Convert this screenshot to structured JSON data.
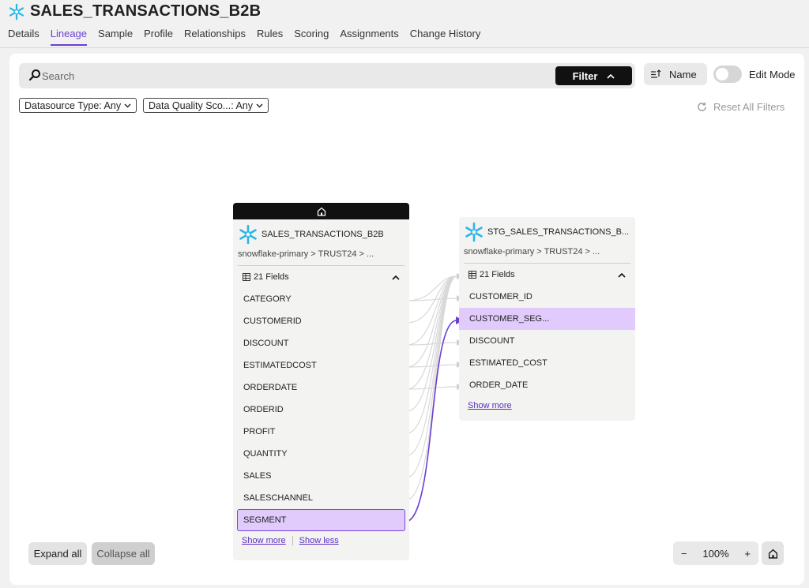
{
  "header": {
    "title": "SALES_TRANSACTIONS_B2B",
    "tabs": [
      {
        "label": "Details"
      },
      {
        "label": "Lineage"
      },
      {
        "label": "Sample"
      },
      {
        "label": "Profile"
      },
      {
        "label": "Relationships"
      },
      {
        "label": "Rules"
      },
      {
        "label": "Scoring"
      },
      {
        "label": "Assignments"
      },
      {
        "label": "Change History"
      }
    ],
    "active_tab": "Lineage"
  },
  "toolbar": {
    "search_placeholder": "Search",
    "filter_label": "Filter",
    "sort_label": "Name",
    "edit_mode_label": "Edit Mode",
    "edit_mode_on": false,
    "filters": [
      {
        "label": "Datasource Type: Any"
      },
      {
        "label": "Data Quality Sco...: Any"
      }
    ],
    "reset_label": "Reset All Filters"
  },
  "source_node": {
    "name": "SALES_TRANSACTIONS_B2B",
    "path": "snowflake-primary  >  TRUST24  >  ...",
    "fields_count": "21 Fields",
    "fields": [
      "CATEGORY",
      "CUSTOMERID",
      "DISCOUNT",
      "ESTIMATEDCOST",
      "ORDERDATE",
      "ORDERID",
      "PROFIT",
      "QUANTITY",
      "SALES",
      "SALESCHANNEL",
      "SEGMENT"
    ],
    "selected_field": "SEGMENT",
    "show_more": "Show more",
    "show_less": "Show less"
  },
  "target_node": {
    "name": "STG_SALES_TRANSACTIONS_B...",
    "path": "snowflake-primary  >  TRUST24  >  ...",
    "fields_count": "21 Fields",
    "fields": [
      "CUSTOMER_ID",
      "CUSTOMER_SEG...",
      "DISCOUNT",
      "ESTIMATED_COST",
      "ORDER_DATE"
    ],
    "selected_field": "CUSTOMER_SEG...",
    "show_more": "Show more"
  },
  "canvas_controls": {
    "expand_all": "Expand all",
    "collapse_all": "Collapse all",
    "zoom_level": "100%",
    "zoom_out": "−",
    "zoom_in": "+"
  },
  "colors": {
    "accent": "#6b3fd3",
    "selected_row": "#e0cbfc",
    "snowflake": "#29b5e8"
  }
}
